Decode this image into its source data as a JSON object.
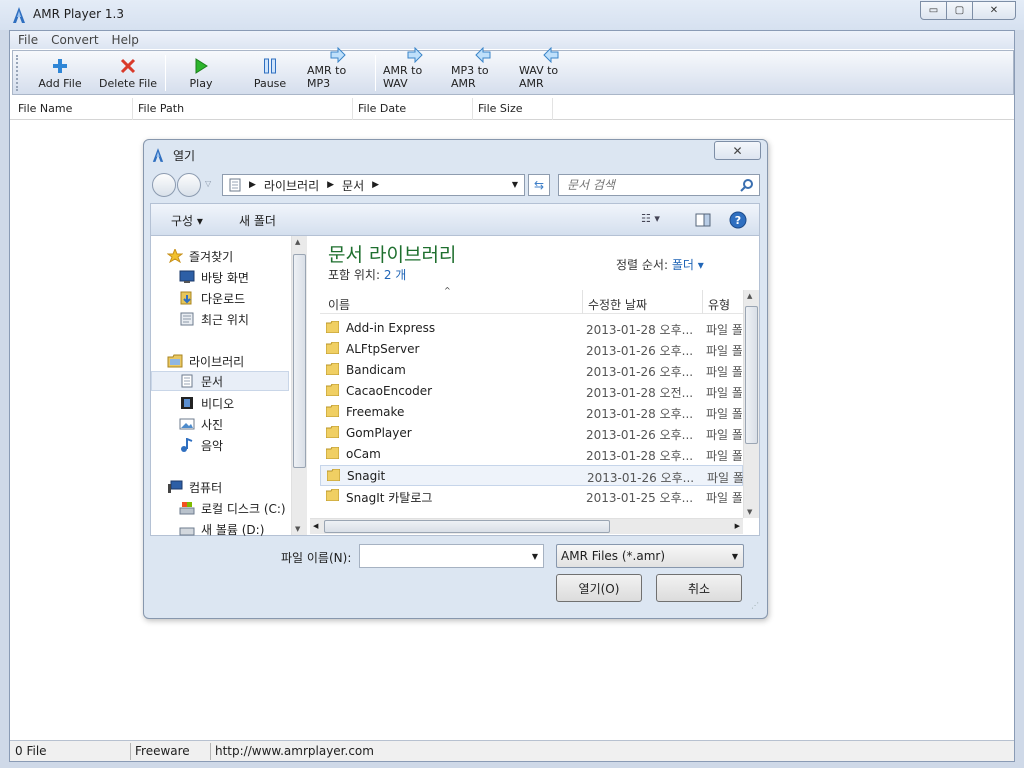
{
  "window": {
    "title": "AMR Player 1.3",
    "buttons": {
      "minimize": "▭",
      "maximize": "▢",
      "close": "✕"
    }
  },
  "menu": [
    "File",
    "Convert",
    "Help"
  ],
  "toolbar": [
    {
      "label": "Add File",
      "icon": "plus-icon"
    },
    {
      "label": "Delete File",
      "icon": "x-icon"
    },
    {
      "label": "Play",
      "icon": "play-icon"
    },
    {
      "label": "Pause",
      "icon": "pause-icon"
    },
    {
      "label": "AMR to MP3",
      "icon": "arrow-right-icon"
    },
    {
      "label": "AMR to WAV",
      "icon": "arrow-right-icon"
    },
    {
      "label": "MP3 to AMR",
      "icon": "arrow-left-icon"
    },
    {
      "label": "WAV to AMR",
      "icon": "arrow-left-icon"
    }
  ],
  "columns": [
    "File Name",
    "File Path",
    "File Date",
    "File Size"
  ],
  "status": {
    "count": "0 File",
    "license": "Freeware",
    "url": "http://www.amrplayer.com"
  },
  "dialog": {
    "title": "열기",
    "close_glyph": "✕",
    "breadcrumb": [
      "라이브러리",
      "문서"
    ],
    "search_placeholder": "문서 검색",
    "organize": "구성 ▾",
    "new_folder": "새 폴더",
    "library_title": "문서 라이브러리",
    "includes_label": "포함 위치:",
    "includes_value": "2 개",
    "sort_label": "정렬 순서:",
    "sort_value": "폴더 ▾",
    "headers": {
      "name": "이름",
      "date": "수정한 날짜",
      "type": "유형"
    },
    "nav": {
      "favorites": "즐겨찾기",
      "desktop": "바탕 화면",
      "downloads": "다운로드",
      "recent": "최근 위치",
      "libraries": "라이브러리",
      "documents": "문서",
      "videos": "비디오",
      "pictures": "사진",
      "music": "음악",
      "computer": "컴퓨터",
      "local_disk": "로컬 디스크 (C:)",
      "new_volume": "새 볼륨 (D:)"
    },
    "files": [
      {
        "name": "Add-in Express",
        "date": "2013-01-28 오후...",
        "type": "파일 폴더"
      },
      {
        "name": "ALFtpServer",
        "date": "2013-01-26 오후...",
        "type": "파일 폴더"
      },
      {
        "name": "Bandicam",
        "date": "2013-01-26 오후...",
        "type": "파일 폴더"
      },
      {
        "name": "CacaoEncoder",
        "date": "2013-01-28 오전...",
        "type": "파일 폴더"
      },
      {
        "name": "Freemake",
        "date": "2013-01-28 오후...",
        "type": "파일 폴더"
      },
      {
        "name": "GomPlayer",
        "date": "2013-01-26 오후...",
        "type": "파일 폴더"
      },
      {
        "name": "oCam",
        "date": "2013-01-28 오후...",
        "type": "파일 폴더"
      },
      {
        "name": "Snagit",
        "date": "2013-01-26 오후...",
        "type": "파일 폴더"
      },
      {
        "name": "SnagIt 카탈로그",
        "date": "2013-01-25 오후...",
        "type": "파일 폴더"
      }
    ],
    "filename_label": "파일 이름(N):",
    "filename_value": "",
    "filetype_value": "AMR Files (*.amr)",
    "open_button": "열기(O)",
    "cancel_button": "취소"
  },
  "colors": {
    "accent_green": "#1e6f2e",
    "link_blue": "#2166b7",
    "chrome": "#d6e1f0"
  }
}
